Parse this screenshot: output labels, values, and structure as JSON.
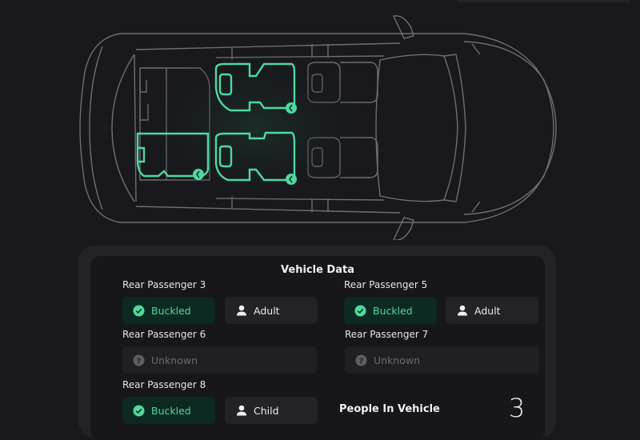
{
  "vehicle_data": {
    "title": "Vehicle Data",
    "passengers": [
      {
        "label": "Rear Passenger 3",
        "status": "Buckled",
        "status_icon": "check-circle-icon",
        "type": "Adult",
        "type_icon": "person-icon"
      },
      {
        "label": "Rear Passenger 5",
        "status": "Buckled",
        "status_icon": "check-circle-icon",
        "type": "Adult",
        "type_icon": "person-icon"
      },
      {
        "label": "Rear Passenger 6",
        "status": "Unknown",
        "status_icon": "question-circle-icon"
      },
      {
        "label": "Rear Passenger 7",
        "status": "Unknown",
        "status_icon": "question-circle-icon"
      },
      {
        "label": "Rear Passenger 8",
        "status": "Buckled",
        "status_icon": "check-circle-icon",
        "type": "Child",
        "type_icon": "person-icon"
      }
    ],
    "people_in_vehicle_label": "People In Vehicle",
    "people_in_vehicle_count": "3"
  },
  "car_diagram": {
    "occupied_seats": [
      "rear-passenger-3",
      "rear-passenger-5",
      "rear-passenger-6-cargo",
      "rear-passenger-8"
    ],
    "unoccupied_seats": [
      "driver",
      "front-passenger"
    ]
  },
  "colors": {
    "background": "#18181d",
    "accent_green": "#4fd9a0",
    "buckled_bg": "#0c2a21",
    "outline_gray": "#6e6e74"
  }
}
